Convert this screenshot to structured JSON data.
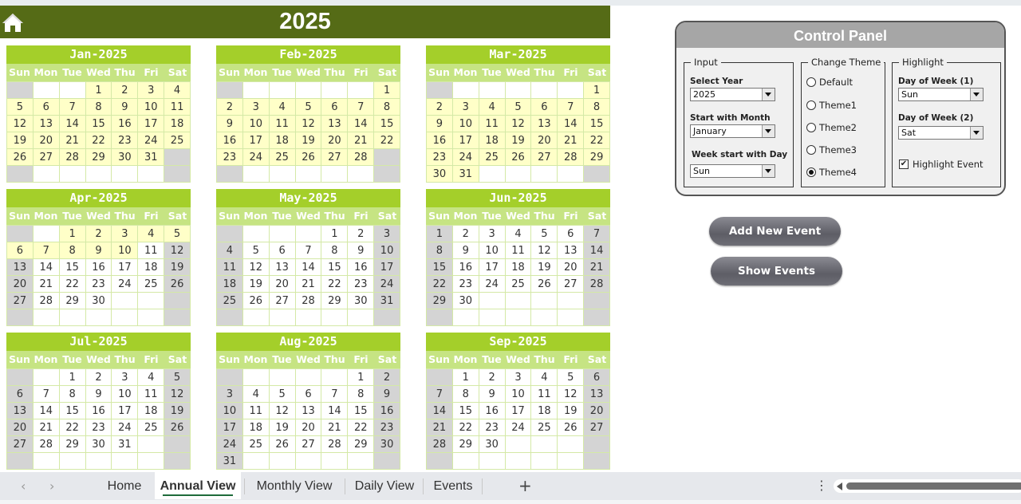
{
  "header": {
    "title": "2025",
    "home_icon": "home-icon"
  },
  "weekdays": [
    "Sun",
    "Mon",
    "Tue",
    "Wed",
    "Thu",
    "Fri",
    "Sat"
  ],
  "highlight_cutoff": {
    "month_index": 3,
    "day": 11
  },
  "colors": {
    "header_bg": "#556b16",
    "month_title_bg": "#a4cf2a",
    "weekday_bg": "#c6e483",
    "past_cell": "#ffffc8",
    "weekend_cell": "#d4d4d4",
    "grid_line": "#d4e9a6"
  },
  "months": [
    {
      "title": "Jan-2025",
      "start": 3,
      "days": 31
    },
    {
      "title": "Feb-2025",
      "start": 6,
      "days": 28
    },
    {
      "title": "Mar-2025",
      "start": 6,
      "days": 31
    },
    {
      "title": "Apr-2025",
      "start": 2,
      "days": 30
    },
    {
      "title": "May-2025",
      "start": 4,
      "days": 31
    },
    {
      "title": "Jun-2025",
      "start": 0,
      "days": 30
    },
    {
      "title": "Jul-2025",
      "start": 2,
      "days": 31
    },
    {
      "title": "Aug-2025",
      "start": 5,
      "days": 31
    },
    {
      "title": "Sep-2025",
      "start": 1,
      "days": 30
    }
  ],
  "control_panel": {
    "title": "Control Panel",
    "input": {
      "label": "Input",
      "select_year_label": "Select Year",
      "select_year_value": "2025",
      "start_month_label": "Start with Month",
      "start_month_value": "January",
      "week_start_label": "Week start with Day",
      "week_start_value": "Sun"
    },
    "theme": {
      "label": "Change Theme",
      "options": [
        "Default",
        "Theme1",
        "Theme2",
        "Theme3",
        "Theme4"
      ],
      "selected": "Theme4"
    },
    "highlight": {
      "label": "Highlight",
      "dow1_label": "Day of Week (1)",
      "dow1_value": "Sun",
      "dow2_label": "Day of Week (2)",
      "dow2_value": "Sat",
      "event_label": "Highlight Event",
      "event_checked": true
    }
  },
  "buttons": {
    "add_event": "Add New Event",
    "show_events": "Show Events"
  },
  "tabs": [
    {
      "label": "Home",
      "active": false
    },
    {
      "label": "Annual View",
      "active": true
    },
    {
      "label": "Monthly View",
      "active": false
    },
    {
      "label": "Daily View",
      "active": false
    },
    {
      "label": "Events",
      "active": false
    }
  ],
  "tabbar": {
    "prev_icon": "‹",
    "next_icon": "›",
    "add_icon": "+",
    "more_icon": "⋮"
  }
}
